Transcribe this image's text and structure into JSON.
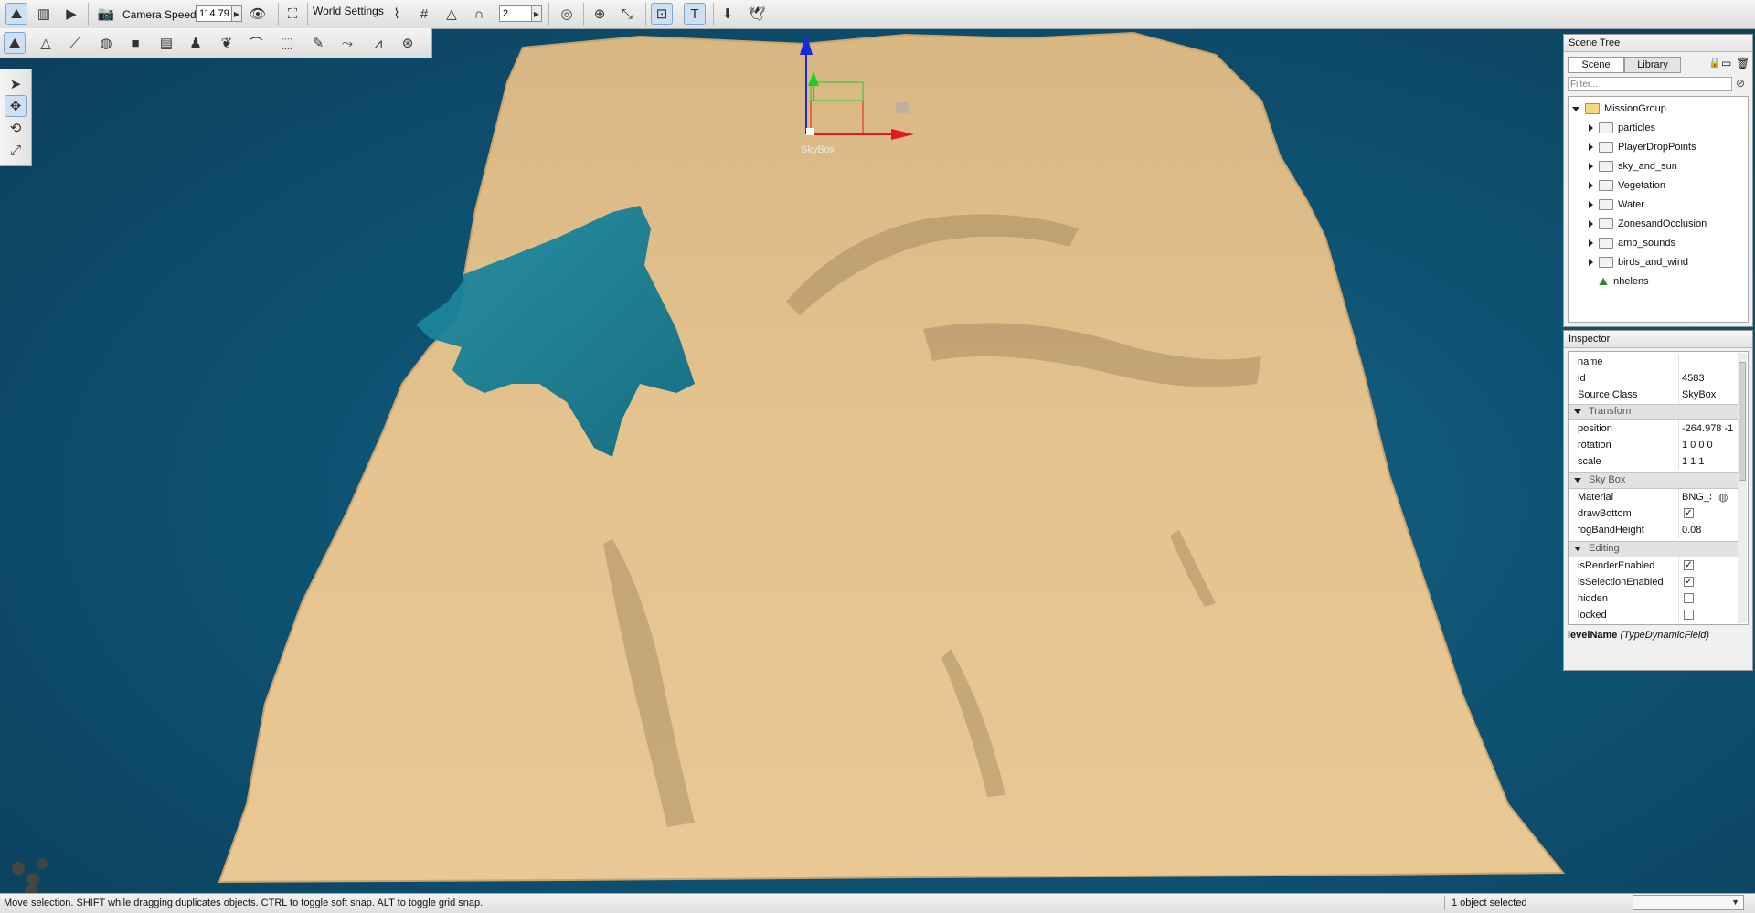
{
  "toolbar": {
    "camera_speed_label": "Camera Speed",
    "camera_speed_value": "114.79",
    "world_settings_label": "World Settings",
    "grid_value": "2"
  },
  "gizmo": {
    "object_label": "SkyBox"
  },
  "scene_tree": {
    "title": "Scene Tree",
    "tabs": [
      "Scene",
      "Library"
    ],
    "filter_placeholder": "Filter...",
    "root": "MissionGroup",
    "items": [
      "particles",
      "PlayerDropPoints",
      "sky_and_sun",
      "Vegetation",
      "Water",
      "ZonesandOcclusion",
      "amb_sounds",
      "birds_and_wind",
      "nhelens"
    ]
  },
  "inspector": {
    "title": "Inspector",
    "fields": [
      {
        "k": "name",
        "v": ""
      },
      {
        "k": "id",
        "v": "4583"
      },
      {
        "k": "Source Class",
        "v": "SkyBox"
      }
    ],
    "transform": {
      "label": "Transform",
      "rows": [
        {
          "k": "position",
          "v": "-264.978 -1"
        },
        {
          "k": "rotation",
          "v": "1 0 0 0"
        },
        {
          "k": "scale",
          "v": "1 1 1"
        }
      ]
    },
    "skybox": {
      "label": "Sky Box",
      "material_k": "Material",
      "material_v": "BNG_S",
      "drawbottom_k": "drawBottom",
      "fog_k": "fogBandHeight",
      "fog_v": "0.08"
    },
    "editing": {
      "label": "Editing",
      "rows": [
        {
          "k": "isRenderEnabled",
          "checked": true
        },
        {
          "k": "isSelectionEnabled",
          "checked": true
        },
        {
          "k": "hidden",
          "checked": false
        },
        {
          "k": "locked",
          "checked": false
        }
      ]
    },
    "footer_name": "levelName",
    "footer_type": "(TypeDynamicField)"
  },
  "status": {
    "message": "Move selection.  SHIFT while dragging duplicates objects.  CTRL to toggle soft snap.  ALT to toggle grid snap.",
    "selection": "1 object selected"
  },
  "colors": {
    "water": "#0f5576",
    "terrain": "#e6c08a",
    "accent": "#7ea4cc"
  }
}
